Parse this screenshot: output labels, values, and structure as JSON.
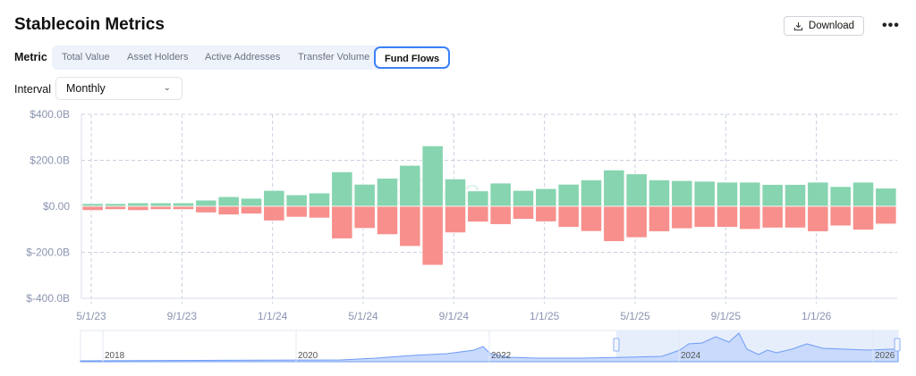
{
  "header": {
    "title": "Stablecoin Metrics",
    "download_label": "Download",
    "download_icon": "download-icon",
    "more_icon": "more-horizontal-icon",
    "more_glyph": "•••"
  },
  "metric": {
    "label": "Metric",
    "tabs": [
      {
        "label": "Total Value"
      },
      {
        "label": "Asset Holders"
      },
      {
        "label": "Active Addresses"
      },
      {
        "label": "Transfer Volume"
      },
      {
        "label": "Fund Flows",
        "active": true
      }
    ]
  },
  "interval": {
    "label": "Interval",
    "value": "Monthly"
  },
  "watermark": "rwa.xyz",
  "colors": {
    "inflow": "#86d4b0",
    "outflow": "#f78f8c",
    "grid": "#c9cfe0",
    "axis_text": "#8a94b0",
    "accent": "#3b82f6"
  },
  "chart_data": {
    "type": "bar",
    "title": "",
    "xlabel": "",
    "ylabel": "",
    "ylim": [
      -400,
      400
    ],
    "y_ticks": [
      "$400.0B",
      "$200.0B",
      "$0.00",
      "$-200.0B",
      "$-400.0B"
    ],
    "y_tick_values": [
      400,
      200,
      0,
      -200,
      -400
    ],
    "x_ticks": [
      {
        "label": "5/1/23",
        "month": "2023-05"
      },
      {
        "label": "9/1/23",
        "month": "2023-09"
      },
      {
        "label": "1/1/24",
        "month": "2024-01"
      },
      {
        "label": "5/1/24",
        "month": "2024-05"
      },
      {
        "label": "9/1/24",
        "month": "2024-09"
      },
      {
        "label": "1/1/25",
        "month": "2025-01"
      },
      {
        "label": "5/1/25",
        "month": "2025-05"
      },
      {
        "label": "9/1/25",
        "month": "2025-09"
      },
      {
        "label": "1/1/26",
        "month": "2026-01"
      }
    ],
    "grid": true,
    "categories": [
      "2023-05",
      "2023-06",
      "2023-07",
      "2023-08",
      "2023-09",
      "2023-10",
      "2023-11",
      "2023-12",
      "2024-01",
      "2024-02",
      "2024-03",
      "2024-04",
      "2024-05",
      "2024-06",
      "2024-07",
      "2024-08",
      "2024-09",
      "2024-10",
      "2024-11",
      "2024-12",
      "2025-01",
      "2025-02",
      "2025-03",
      "2025-04",
      "2025-05",
      "2025-06",
      "2025-07",
      "2025-08",
      "2025-09",
      "2025-10",
      "2025-11",
      "2025-12",
      "2026-01",
      "2026-02",
      "2026-03",
      "2026-04"
    ],
    "series": [
      {
        "values": [
          12,
          12,
          15,
          15,
          15,
          27,
          42,
          35,
          69,
          50,
          58,
          150,
          96,
          122,
          178,
          263,
          119,
          67,
          101,
          69,
          77,
          96,
          115,
          158,
          141,
          115,
          112,
          109,
          105,
          105,
          95,
          95,
          105,
          86,
          105,
          79
        ]
      },
      {
        "values": [
          -18,
          -14,
          -18,
          -14,
          -14,
          -28,
          -37,
          -33,
          -63,
          -47,
          -51,
          -141,
          -96,
          -123,
          -174,
          -256,
          -115,
          -68,
          -79,
          -56,
          -67,
          -91,
          -109,
          -153,
          -136,
          -110,
          -97,
          -91,
          -91,
          -100,
          -94,
          -94,
          -110,
          -85,
          -103,
          -77
        ]
      }
    ],
    "navigator": {
      "year_labels": [
        "2018",
        "2020",
        "2022",
        "2024",
        "2026"
      ]
    }
  }
}
